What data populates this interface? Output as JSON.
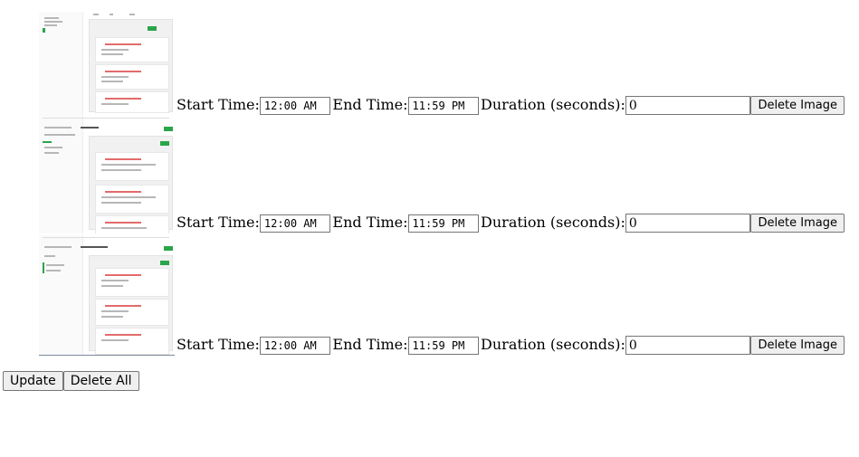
{
  "rows": [
    {
      "start_label": "Start Time:",
      "start_value": "12:00 AM",
      "end_label": "End Time:",
      "end_value": "11:59 PM",
      "duration_label": "Duration (seconds):",
      "duration_value": "0",
      "delete_label": "Delete Image"
    },
    {
      "start_label": "Start Time:",
      "start_value": "12:00 AM",
      "end_label": "End Time:",
      "end_value": "11:59 PM",
      "duration_label": "Duration (seconds):",
      "duration_value": "0",
      "delete_label": "Delete Image"
    },
    {
      "start_label": "Start Time:",
      "start_value": "12:00 AM",
      "end_label": "End Time:",
      "end_value": "11:59 PM",
      "duration_label": "Duration (seconds):",
      "duration_value": "0",
      "delete_label": "Delete Image"
    }
  ],
  "actions": {
    "update_label": "Update",
    "delete_all_label": "Delete All"
  }
}
